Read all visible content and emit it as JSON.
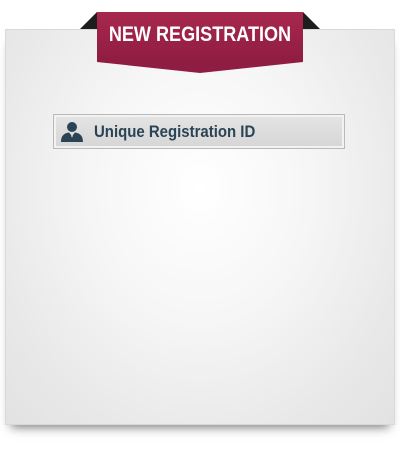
{
  "banner": {
    "title": "NEW REGISTRATION",
    "color": "#9a2148"
  },
  "form": {
    "registration_field": {
      "label": "Unique Registration ID",
      "icon": "user-icon"
    }
  }
}
